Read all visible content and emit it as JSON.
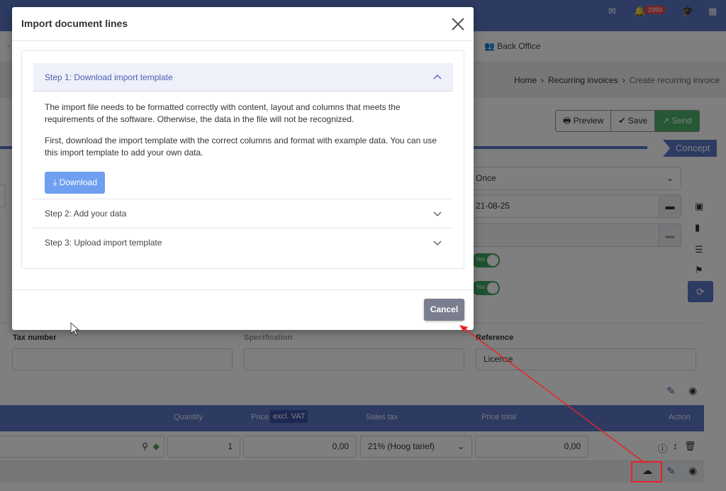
{
  "topbar": {
    "notification_count": "2999"
  },
  "navbar": {
    "back_office": "Back Office"
  },
  "breadcrumb": {
    "home": "Home",
    "recurring": "Recurring invoices",
    "current": "Create recurring invoice"
  },
  "toolbar": {
    "preview": "Preview",
    "save": "Save",
    "send": "Send"
  },
  "status": {
    "concept": "Concept"
  },
  "form": {
    "frequency": "Once",
    "date": "21-08-25",
    "toggle_yes": "Yes",
    "tax_number_label": "Tax number",
    "specification_label": "Specification",
    "reference_label": "Reference",
    "reference_value": "License"
  },
  "lines_table": {
    "headers": {
      "quantity": "Quantity",
      "price": "Price",
      "excl_vat": "excl. VAT",
      "sales_tax": "Sales tax",
      "price_total": "Price total",
      "action": "Action"
    },
    "row": {
      "quantity": "1",
      "price": "0,00",
      "sales_tax": "21% (Hoog tarief)",
      "total": "0,00"
    }
  },
  "modal": {
    "title": "Import document lines",
    "step1_title": "Step 1: Download import template",
    "step1_p1": "The import file needs to be formatted correctly with content, layout and columns that meets the requirements of the software. Otherwise, the data in the file will not be recognized.",
    "step1_p2": "First, download the import template with the correct columns and format with example data. You can use this import template to add your own data.",
    "download": "Download",
    "step2_title": "Step 2: Add your data",
    "step3_title": "Step 3: Upload import template",
    "cancel": "Cancel"
  },
  "colors": {
    "brand": "#5a76c4",
    "send": "#4fb06b",
    "highlight": "#e8222a",
    "download": "#6f9ff0",
    "cancel": "#7a7e8e"
  }
}
